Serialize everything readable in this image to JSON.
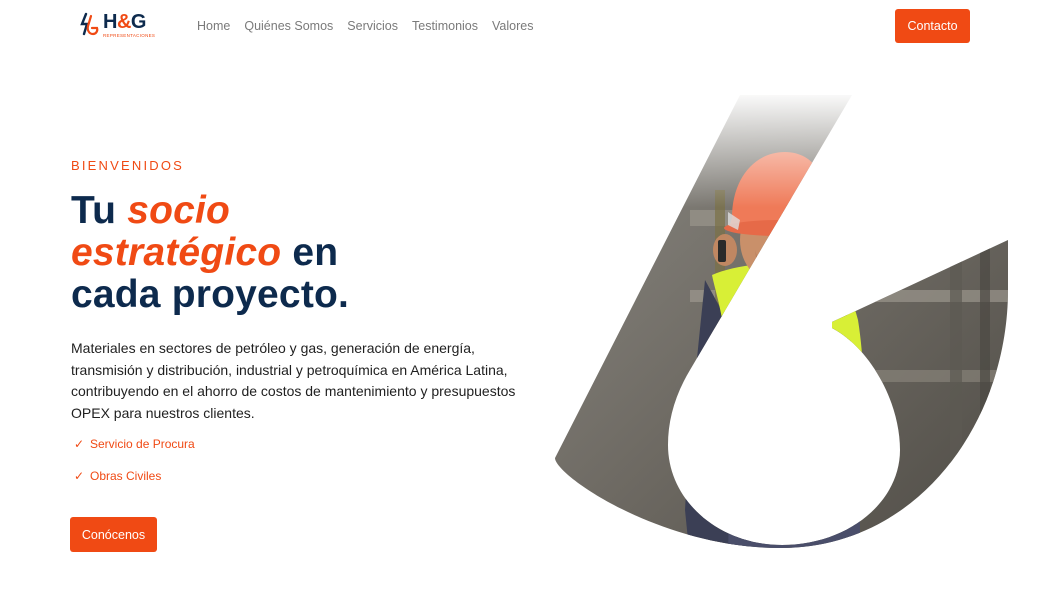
{
  "header": {
    "logo": {
      "brand_prefix": "H",
      "brand_amp": "&",
      "brand_suffix": "G",
      "tagline": "REPRESENTACIONES",
      "icon": "hg-logo-mark-icon"
    },
    "nav": [
      {
        "label": "Home"
      },
      {
        "label": "Quiénes Somos"
      },
      {
        "label": "Servicios"
      },
      {
        "label": "Testimonios"
      },
      {
        "label": "Valores"
      }
    ],
    "contact_label": "Contacto"
  },
  "hero": {
    "eyebrow": "BIENVENIDOS",
    "headline": {
      "part1": "Tu ",
      "accent1": "socio",
      "accent2": "estratégico",
      "part2": " en",
      "part3": "cada proyecto."
    },
    "description": "Materiales en sectores de petróleo y gas, generación de energía, transmisión y distribución, industrial y petroquímica en América Latina, contribuyendo en el ahorro de costos de mantenimiento y presupuestos OPEX para nuestros clientes.",
    "features": [
      {
        "label": "Servicio de Procura",
        "icon": "checkmark-icon"
      },
      {
        "label": "Obras Civiles",
        "icon": "checkmark-icon"
      }
    ],
    "cta_label": "Conócenos",
    "image": "construction-worker-hardhat-safety-vest-photo"
  },
  "colors": {
    "accent": "#f04a14",
    "navy": "#0d2a4d",
    "nav_text": "#7a7a7a"
  }
}
